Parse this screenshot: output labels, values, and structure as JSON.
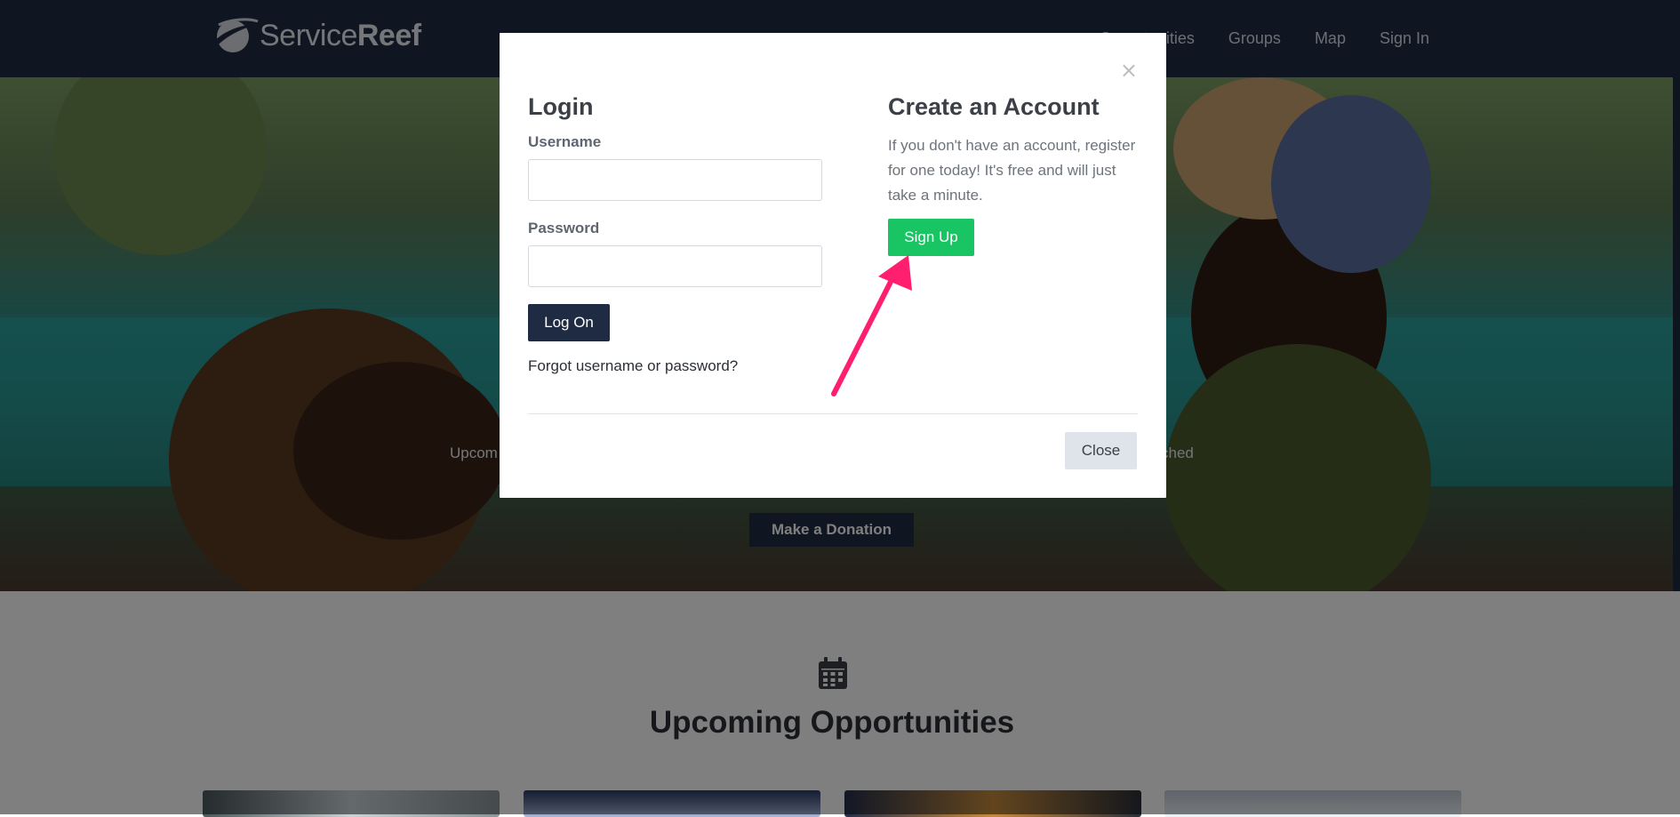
{
  "navbar": {
    "logo": {
      "text_regular": "Service",
      "text_bold": "Reef"
    },
    "links": [
      {
        "label": "Opportunities"
      },
      {
        "label": "Groups"
      },
      {
        "label": "Map"
      },
      {
        "label": "Sign In"
      }
    ]
  },
  "hero": {
    "text_left": "Upcom",
    "text_right": "ched",
    "donate_label": "Make a Donation"
  },
  "section": {
    "title": "Upcoming Opportunities",
    "icon": "calendar-icon"
  },
  "modal": {
    "close_symbol": "×",
    "login": {
      "title": "Login",
      "username_label": "Username",
      "username_value": "",
      "password_label": "Password",
      "password_value": "",
      "logon_label": "Log On",
      "forgot_label": "Forgot username or password?"
    },
    "create": {
      "title": "Create an Account",
      "text": "If you don't have an account, register for one today! It's free and will just take a minute.",
      "signup_label": "Sign Up"
    },
    "close_label": "Close"
  },
  "colors": {
    "nav_bg": "#1f2b43",
    "signup_green": "#19c463",
    "arrow_pink": "#ff1f6e"
  }
}
